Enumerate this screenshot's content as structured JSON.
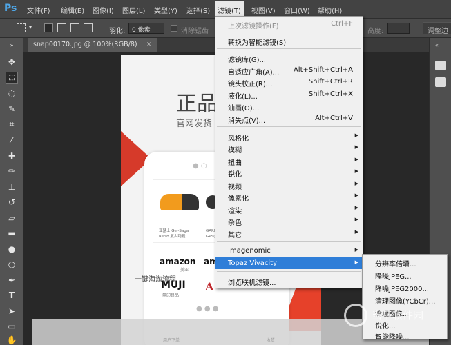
{
  "app": {
    "logo": "Ps"
  },
  "menubar": [
    {
      "label": "文件(F)"
    },
    {
      "label": "编辑(E)"
    },
    {
      "label": "图像(I)"
    },
    {
      "label": "图层(L)"
    },
    {
      "label": "类型(Y)"
    },
    {
      "label": "选择(S)"
    },
    {
      "label": "滤镜(T)"
    },
    {
      "label": "视图(V)"
    },
    {
      "label": "窗口(W)"
    },
    {
      "label": "帮助(H)"
    }
  ],
  "options": {
    "feather_label": "羽化:",
    "feather_value": "0 像素",
    "antialias_label": "消除锯齿",
    "height_label": "高度:",
    "refine_edge_button": "调整边"
  },
  "document_tab": {
    "label": "snap00170.jpg @ 100%(RGB/8)",
    "close": "×"
  },
  "canvas": {
    "title": "正品",
    "subtitle": "官网发货",
    "product1_text": [
      "亚瑟士 Gel-Saga",
      "Retro 复古跑鞋"
    ],
    "product2_text": [
      "GARM",
      "GPS("
    ],
    "brand_amazon": "amazon",
    "brand_amazon_sub": "美亚",
    "brand_amazon2": "ama",
    "brand_muji": "MUJI",
    "brand_muji_sub": "無印良品",
    "brand_a": "A",
    "flow_title": "一键海淘流程",
    "bottom_left": "用户下单",
    "bottom_right": "收货"
  },
  "filter_menu": {
    "items": [
      {
        "label": "上次滤镜操作(F)",
        "shortcut": "Ctrl+F",
        "disabled": true
      },
      {
        "label": "转换为智能滤镜(S)"
      },
      {
        "label": "滤镜库(G)..."
      },
      {
        "label": "自适应广角(A)...",
        "shortcut": "Alt+Shift+Ctrl+A"
      },
      {
        "label": "镜头校正(R)...",
        "shortcut": "Shift+Ctrl+R"
      },
      {
        "label": "液化(L)...",
        "shortcut": "Shift+Ctrl+X"
      },
      {
        "label": "油画(O)..."
      },
      {
        "label": "消失点(V)...",
        "shortcut": "Alt+Ctrl+V"
      },
      {
        "label": "风格化"
      },
      {
        "label": "模糊"
      },
      {
        "label": "扭曲"
      },
      {
        "label": "锐化"
      },
      {
        "label": "视频"
      },
      {
        "label": "像素化"
      },
      {
        "label": "渲染"
      },
      {
        "label": "杂色"
      },
      {
        "label": "其它"
      },
      {
        "label": "Imagenomic"
      },
      {
        "label": "Topaz Vivacity"
      },
      {
        "label": "浏览联机滤镜..."
      }
    ]
  },
  "submenu": {
    "items": [
      {
        "label": "分辨率倍增..."
      },
      {
        "label": "降噪JPEG..."
      },
      {
        "label": "降噪JPEG2000..."
      },
      {
        "label": "清理图像(YCbCr)..."
      },
      {
        "label": "清理图像..."
      },
      {
        "label": "锐化..."
      },
      {
        "label": "智能降噪..."
      }
    ]
  },
  "watermark": {
    "text": "当下软件园"
  },
  "colors": {
    "highlight": "#2f7ed8",
    "ps_blue": "#4fa7e8",
    "accent_red": "#d63a2a"
  }
}
